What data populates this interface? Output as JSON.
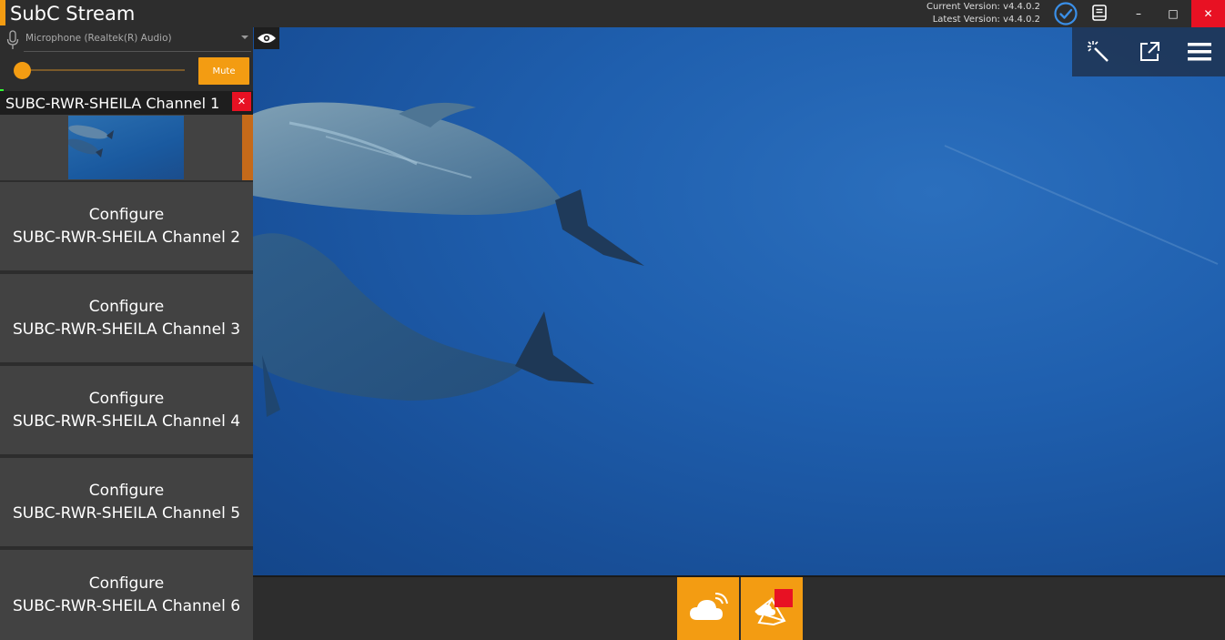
{
  "titlebar": {
    "app_title": "SubC Stream",
    "current_version": "Current Version: v4.4.0.2",
    "latest_version": "Latest Version: v4.4.0.2",
    "minimize_glyph": "–",
    "maximize_glyph": "□",
    "close_glyph": "✕",
    "icons": [
      "check-circle-icon",
      "book-icon"
    ]
  },
  "audio": {
    "mic_device": "Microphone (Realtek(R) Audio)",
    "mute_label": "Mute",
    "volume_level": 0.0
  },
  "channel1": {
    "title": "SUBC-RWR-SHEILA Channel 1",
    "close_glyph": "✕"
  },
  "configure": {
    "prefix": "Configure",
    "items": [
      {
        "label": "SUBC-RWR-SHEILA Channel 2"
      },
      {
        "label": "SUBC-RWR-SHEILA Channel 3"
      },
      {
        "label": "SUBC-RWR-SHEILA Channel 4"
      },
      {
        "label": "SUBC-RWR-SHEILA Channel 5"
      },
      {
        "label": "SUBC-RWR-SHEILA Channel 6"
      }
    ]
  },
  "video_toolbar": {
    "icons": [
      "magic-wand-icon",
      "popout-icon",
      "hamburger-menu-icon"
    ]
  },
  "bottom_bar": {
    "icons": [
      "cloud-stream-icon",
      "cloud-network-icon"
    ]
  },
  "colors": {
    "accent": "#f39c12",
    "close_red": "#e81123",
    "panel_bg": "#2d2d2d",
    "tile_bg": "#424242"
  }
}
